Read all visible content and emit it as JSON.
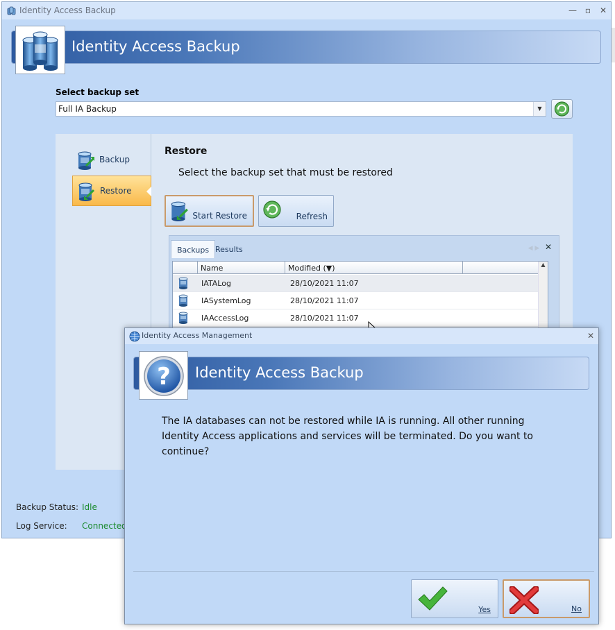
{
  "main": {
    "window_title": "Identity Access Backup",
    "banner_title": "Identity Access Backup",
    "select_label": "Select backup set",
    "backup_set_value": "Full IA Backup",
    "nav": [
      {
        "label": "Backup"
      },
      {
        "label": "Restore"
      }
    ],
    "section_title": "Restore",
    "section_description": "Select the backup set that must be restored",
    "start_restore_label": "Start Restore",
    "refresh_label": "Refresh",
    "tabs": [
      {
        "label": "Backups"
      },
      {
        "label": "Results"
      }
    ],
    "grid": {
      "columns": [
        "Name",
        "Modified"
      ],
      "sort_indicator": "(▼)",
      "rows": [
        {
          "name": "IATALog",
          "modified": "28/10/2021 11:07"
        },
        {
          "name": "IASystemLog",
          "modified": "28/10/2021 11:07"
        },
        {
          "name": "IAAccessLog",
          "modified": "28/10/2021 11:07"
        }
      ]
    },
    "status": {
      "backup_label": "Backup Status:",
      "backup_value": "Idle",
      "log_label": "Log Service:",
      "log_value": "Connected"
    }
  },
  "dialog": {
    "window_title": "Identity Access Management",
    "banner_title": "Identity Access Backup",
    "message": "The IA databases can not be restored while IA is running. All other running Identity Access applications and services will be terminated. Do you want to continue?",
    "yes_label": "Yes",
    "no_label": "No"
  },
  "colors": {
    "window_bg": "#c1d9f7",
    "banner_dark": "#2d5aa0",
    "status_green": "#1b8a2e",
    "nav_active": "#f9b94a"
  }
}
